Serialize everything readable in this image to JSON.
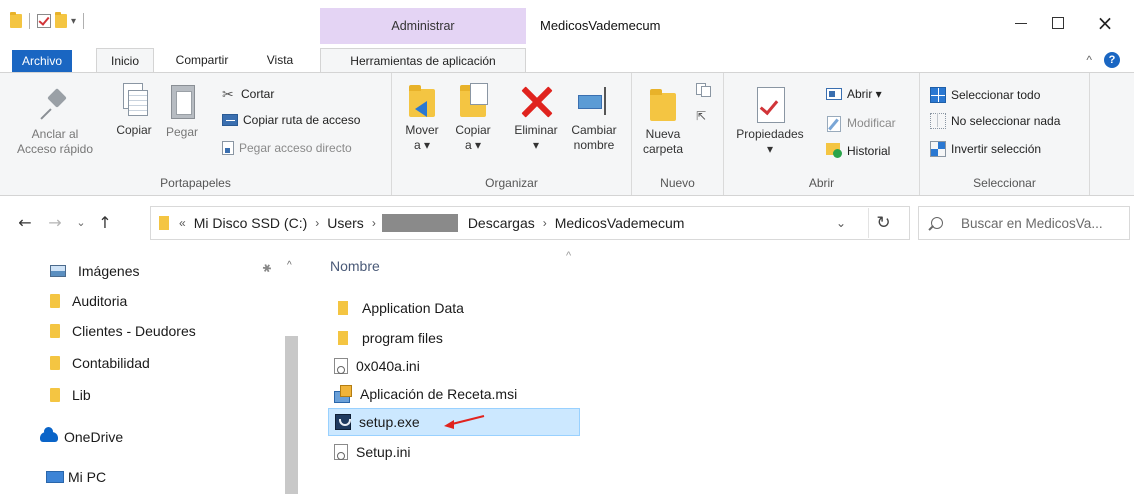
{
  "titlebar": {
    "window_title": "MedicosVademecum",
    "context_tab_header": "Administrar",
    "qat_dropdown": "▾"
  },
  "ribbon_tabs": {
    "archivo": "Archivo",
    "inicio": "Inicio",
    "compartir": "Compartir",
    "vista": "Vista",
    "herramientas": "Herramientas de aplicación"
  },
  "ribbon": {
    "portapapeles": {
      "label": "Portapapeles",
      "pin": "Anclar al Acceso rápido",
      "pin_line1": "Anclar al",
      "pin_line2": "Acceso rápido",
      "copy": "Copiar",
      "paste": "Pegar",
      "cut": "Cortar",
      "copy_path": "Copiar ruta de acceso",
      "paste_shortcut": "Pegar acceso directo"
    },
    "organizar": {
      "label": "Organizar",
      "move_line1": "Mover",
      "move_line2": "a ▾",
      "copy_line1": "Copiar",
      "copy_line2": "a ▾",
      "delete_line1": "Eliminar",
      "delete_line2": "▾",
      "rename_line1": "Cambiar",
      "rename_line2": "nombre"
    },
    "nuevo": {
      "label": "Nuevo",
      "folder_line1": "Nueva",
      "folder_line2": "carpeta"
    },
    "abrir": {
      "label": "Abrir",
      "props_line1": "Propiedades",
      "props_line2": "▾",
      "open": "Abrir ▾",
      "modify": "Modificar",
      "history": "Historial"
    },
    "seleccionar": {
      "label": "Seleccionar",
      "select_all": "Seleccionar todo",
      "select_none": "No seleccionar nada",
      "invert": "Invertir selección"
    }
  },
  "address": {
    "overflow": "«",
    "crumbs": [
      "Mi Disco SSD (C:)",
      "Users",
      "Descargas",
      "MedicosVademecum"
    ],
    "search_placeholder": "Buscar en MedicosVa..."
  },
  "nav_pane": {
    "items": [
      "Imágenes",
      "Auditoria",
      "Clientes - Deudores",
      "Contabilidad",
      "Lib",
      "OneDrive",
      "Mi PC"
    ]
  },
  "file_list": {
    "column_name": "Nombre",
    "files": [
      {
        "name": "Application Data",
        "type": "folder"
      },
      {
        "name": "program files",
        "type": "folder"
      },
      {
        "name": "0x040a.ini",
        "type": "ini"
      },
      {
        "name": "Aplicación de Receta.msi",
        "type": "msi"
      },
      {
        "name": "setup.exe",
        "type": "exe",
        "selected": true
      },
      {
        "name": "Setup.ini",
        "type": "ini"
      }
    ]
  },
  "colors": {
    "accent": "#1a66c2",
    "context_tab": "#e4d4f4",
    "selection": "#cce8ff",
    "folder": "#f4c542",
    "annotation_arrow": "#e0231e"
  }
}
